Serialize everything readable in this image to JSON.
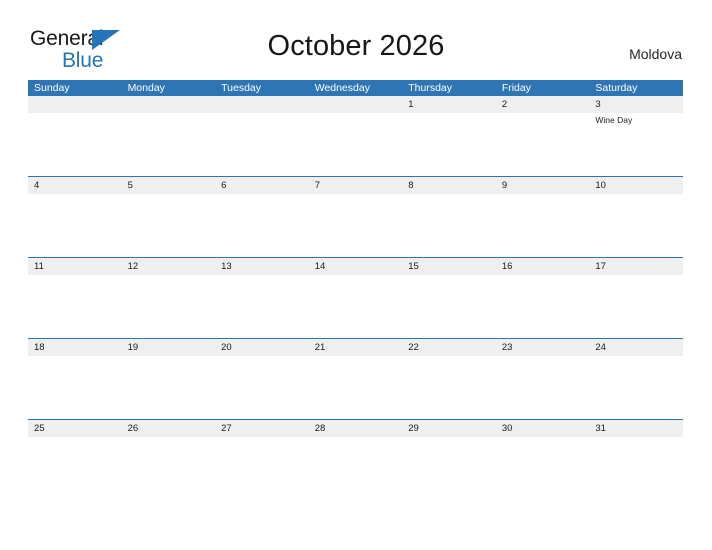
{
  "brand": {
    "name_part1": "General",
    "name_part2": "Blue",
    "flag_icon": "triangle-flag-icon",
    "accent_color": "#2574b7"
  },
  "header": {
    "title": "October 2026",
    "country": "Moldova"
  },
  "colors": {
    "header_blue": "#2e75b6",
    "row_band_gray": "#efefef",
    "separator_blue": "#2e75b6",
    "text_dark": "#1c1c1c"
  },
  "calendar": {
    "month": "October",
    "year": "2026",
    "weekday_headers": [
      "Sunday",
      "Monday",
      "Tuesday",
      "Wednesday",
      "Thursday",
      "Friday",
      "Saturday"
    ],
    "weeks": [
      {
        "days": [
          {
            "number": "",
            "events": []
          },
          {
            "number": "",
            "events": []
          },
          {
            "number": "",
            "events": []
          },
          {
            "number": "",
            "events": []
          },
          {
            "number": "1",
            "events": []
          },
          {
            "number": "2",
            "events": []
          },
          {
            "number": "3",
            "events": [
              "Wine Day"
            ]
          }
        ]
      },
      {
        "days": [
          {
            "number": "4",
            "events": []
          },
          {
            "number": "5",
            "events": []
          },
          {
            "number": "6",
            "events": []
          },
          {
            "number": "7",
            "events": []
          },
          {
            "number": "8",
            "events": []
          },
          {
            "number": "9",
            "events": []
          },
          {
            "number": "10",
            "events": []
          }
        ]
      },
      {
        "days": [
          {
            "number": "11",
            "events": []
          },
          {
            "number": "12",
            "events": []
          },
          {
            "number": "13",
            "events": []
          },
          {
            "number": "14",
            "events": []
          },
          {
            "number": "15",
            "events": []
          },
          {
            "number": "16",
            "events": []
          },
          {
            "number": "17",
            "events": []
          }
        ]
      },
      {
        "days": [
          {
            "number": "18",
            "events": []
          },
          {
            "number": "19",
            "events": []
          },
          {
            "number": "20",
            "events": []
          },
          {
            "number": "21",
            "events": []
          },
          {
            "number": "22",
            "events": []
          },
          {
            "number": "23",
            "events": []
          },
          {
            "number": "24",
            "events": []
          }
        ]
      },
      {
        "days": [
          {
            "number": "25",
            "events": []
          },
          {
            "number": "26",
            "events": []
          },
          {
            "number": "27",
            "events": []
          },
          {
            "number": "28",
            "events": []
          },
          {
            "number": "29",
            "events": []
          },
          {
            "number": "30",
            "events": []
          },
          {
            "number": "31",
            "events": []
          }
        ]
      }
    ]
  }
}
